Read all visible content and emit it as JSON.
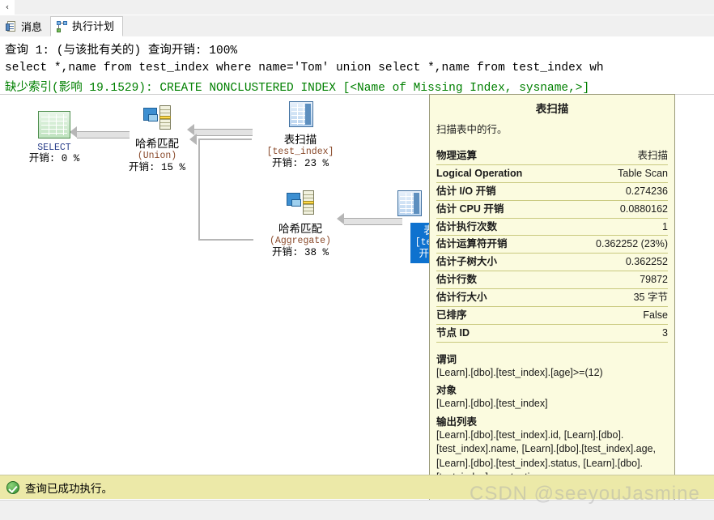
{
  "window": {
    "scroll_left_glyph": "‹"
  },
  "tabs": [
    {
      "label": "消息",
      "icon": "messages-icon",
      "active": false
    },
    {
      "label": "执行计划",
      "icon": "execution-plan-icon",
      "active": true
    }
  ],
  "query_header": {
    "title": "查询 1: (与该批有关的) 查询开销: 100%",
    "sql": "select *,name from test_index where name='Tom' union select *,name from test_index wh",
    "missing_index": "缺少索引(影响 19.1529): CREATE NONCLUSTERED INDEX [<Name of Missing Index, sysname,>]",
    "missing_index_color": "#008000"
  },
  "plan": {
    "nodes": [
      {
        "id": "select",
        "icon": "result-set-icon",
        "title": "SELECT",
        "subtitle": "",
        "cost": "开销: 0 %",
        "selected": false
      },
      {
        "id": "hash-union",
        "icon": "hash-match-icon",
        "title": "哈希匹配",
        "subtitle": "(Union)",
        "cost": "开销: 15 %",
        "selected": false
      },
      {
        "id": "table-scan-top",
        "icon": "table-scan-icon",
        "title": "表扫描",
        "subtitle": "[test_index]",
        "cost": "开销: 23 %",
        "selected": false
      },
      {
        "id": "hash-aggregate",
        "icon": "hash-match-icon",
        "title": "哈希匹配",
        "subtitle": "(Aggregate)",
        "cost": "开销: 38 %",
        "selected": false
      },
      {
        "id": "table-scan-selected",
        "icon": "table-scan-icon",
        "title": "表",
        "subtitle": "[test",
        "cost": "开销",
        "selected": true
      }
    ]
  },
  "tooltip": {
    "title": "表扫描",
    "description": "扫描表中的行。",
    "rows": [
      {
        "key": "物理运算",
        "value": "表扫描"
      },
      {
        "key": "Logical Operation",
        "value": "Table Scan"
      },
      {
        "key": "估计 I/O 开销",
        "value": "0.274236"
      },
      {
        "key": "估计 CPU 开销",
        "value": "0.0880162"
      },
      {
        "key": "估计执行次数",
        "value": "1"
      },
      {
        "key": "估计运算符开销",
        "value": "0.362252 (23%)"
      },
      {
        "key": "估计子树大小",
        "value": "0.362252"
      },
      {
        "key": "估计行数",
        "value": "79872"
      },
      {
        "key": "估计行大小",
        "value": "35 字节"
      },
      {
        "key": "已排序",
        "value": "False"
      },
      {
        "key": "节点 ID",
        "value": "3"
      }
    ],
    "sections": [
      {
        "heading": "谓词",
        "body": "[Learn].[dbo].[test_index].[age]>=(12)"
      },
      {
        "heading": "对象",
        "body": "[Learn].[dbo].[test_index]"
      },
      {
        "heading": "输出列表",
        "body": "[Learn].[dbo].[test_index].id, [Learn].[dbo].[test_index].name, [Learn].[dbo].[test_index].age, [Learn].[dbo].[test_index].status, [Learn].[dbo].[test_index].create_time"
      }
    ]
  },
  "status": {
    "icon": "success-check-icon",
    "message": "查询已成功执行。"
  },
  "watermark": "CSDN @seeyouJasmine"
}
